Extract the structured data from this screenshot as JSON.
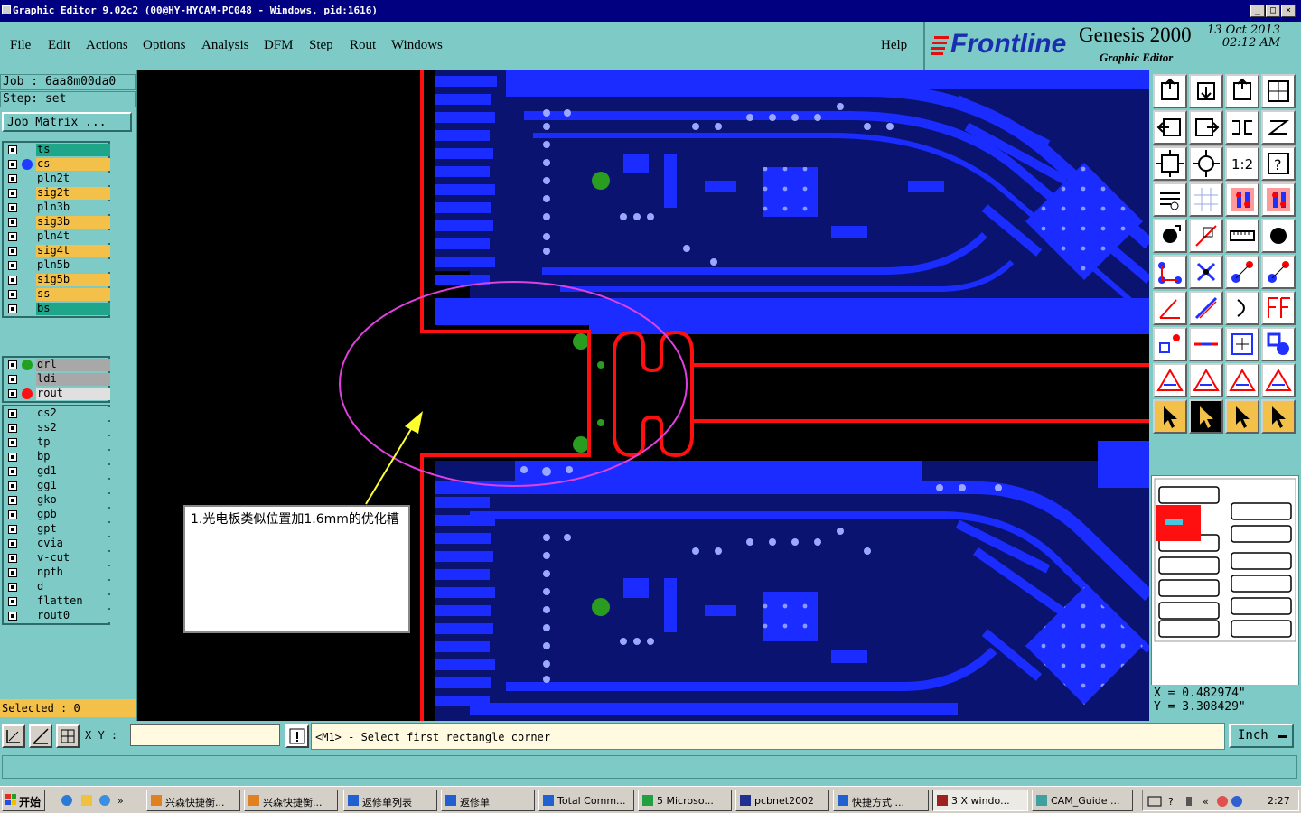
{
  "window": {
    "title": "Graphic Editor 9.02c2 (00@HY-HYCAM-PC048 - Windows, pid:1616)",
    "controls": [
      "_",
      "□",
      "×"
    ]
  },
  "menu": {
    "items": [
      "File",
      "Edit",
      "Actions",
      "Options",
      "Analysis",
      "DFM",
      "Step",
      "Rout",
      "Windows"
    ],
    "help": "Help"
  },
  "logo": {
    "brand": "Frontline",
    "product": "Genesis 2000",
    "subtitle": "Graphic Editor",
    "date": "13 Oct 2013",
    "time": "02:12 AM"
  },
  "job": {
    "job_line": "Job : 6aa8m00da0",
    "step_line": "Step: set",
    "matrix_button": "Job Matrix ..."
  },
  "layers_group1": [
    {
      "name": "ts",
      "color": "#1fa58a",
      "dot": ""
    },
    {
      "name": "cs",
      "color": "#f3c04a",
      "dot": "#1e3cff"
    },
    {
      "name": "pln2t",
      "color": "#7dcac6",
      "dot": ""
    },
    {
      "name": "sig2t",
      "color": "#f3c04a",
      "dot": ""
    },
    {
      "name": "pln3b",
      "color": "#7dcac6",
      "dot": ""
    },
    {
      "name": "sig3b",
      "color": "#f3c04a",
      "dot": ""
    },
    {
      "name": "pln4t",
      "color": "#7dcac6",
      "dot": ""
    },
    {
      "name": "sig4t",
      "color": "#f3c04a",
      "dot": ""
    },
    {
      "name": "pln5b",
      "color": "#7dcac6",
      "dot": ""
    },
    {
      "name": "sig5b",
      "color": "#f3c04a",
      "dot": ""
    },
    {
      "name": "ss",
      "color": "#f3c04a",
      "dot": ""
    },
    {
      "name": "bs",
      "color": "#1fa58a",
      "dot": ""
    }
  ],
  "layers_group2": [
    {
      "name": "drl",
      "color": "#a8a8a8",
      "dot": "#22a020"
    },
    {
      "name": "ldi",
      "color": "#a8a8a8",
      "dot": ""
    },
    {
      "name": "rout",
      "color": "#e0e0e0",
      "dot": "#ff1010"
    }
  ],
  "layers_group3": [
    {
      "name": "cs2",
      "color": "#7dcac6",
      "dot": ""
    },
    {
      "name": "ss2",
      "color": "#7dcac6",
      "dot": ""
    },
    {
      "name": "tp",
      "color": "#7dcac6",
      "dot": ""
    },
    {
      "name": "bp",
      "color": "#7dcac6",
      "dot": ""
    },
    {
      "name": "gd1",
      "color": "#7dcac6",
      "dot": ""
    },
    {
      "name": "gg1",
      "color": "#7dcac6",
      "dot": ""
    },
    {
      "name": "gko",
      "color": "#7dcac6",
      "dot": ""
    },
    {
      "name": "gpb",
      "color": "#7dcac6",
      "dot": ""
    },
    {
      "name": "gpt",
      "color": "#7dcac6",
      "dot": ""
    },
    {
      "name": "cvia",
      "color": "#7dcac6",
      "dot": ""
    },
    {
      "name": "v-cut",
      "color": "#7dcac6",
      "dot": ""
    },
    {
      "name": "npth",
      "color": "#7dcac6",
      "dot": ""
    },
    {
      "name": "d",
      "color": "#7dcac6",
      "dot": ""
    },
    {
      "name": "flatten",
      "color": "#7dcac6",
      "dot": ""
    },
    {
      "name": "rout0",
      "color": "#7dcac6",
      "dot": ""
    }
  ],
  "selected_text": "Selected : 0",
  "annotation": {
    "text": "1.光电板类似位置加1.6mm的优化槽"
  },
  "coords": {
    "x": "X = 0.482974\"",
    "y": "Y = 3.308429\""
  },
  "command": {
    "xy_label": "X Y :",
    "xy_value": "",
    "prompt": "<M1> - Select first rectangle corner",
    "unit": "Inch"
  },
  "taskbar": {
    "start": "开始",
    "tasks": [
      "兴森快捷衡...",
      "兴森快捷衡...",
      "返修单列表",
      "返修单",
      "Total Comm...",
      "5 Microso...",
      "pcbnet2002",
      "快捷方式 ...",
      "3 X windo...",
      "CAM_Guide ..."
    ],
    "clock": "2:27"
  },
  "colors": {
    "copper": "#1a2cff",
    "rout": "#ff1010",
    "pad": "#2a9c20",
    "panel": "#7dcac6",
    "highlight": "#f3c04a"
  },
  "tool_icons": [
    "zoom-home-icon",
    "zoom-in-icon",
    "zoom-home-icon",
    "zoom-fit-icon",
    "pan-left-icon",
    "pan-right-icon",
    "flip-icon",
    "snap-icon",
    "expand-icon",
    "center-icon",
    "scale-1-2-icon",
    "help-icon",
    "measure-icon",
    "grid-icon",
    "layer-red-icon",
    "layer-red-icon",
    "pad-icon",
    "line-icon",
    "ruler-icon",
    "circle-icon",
    "node-icon",
    "cross-icon",
    "connect-icon",
    "connect-icon",
    "angle-icon",
    "slash-icon",
    "arc-icon",
    "flag-icon",
    "point-icon",
    "dash-icon",
    "box-icon",
    "group-icon",
    "triangle-icon",
    "triangle-icon",
    "triangle-icon",
    "triangle-icon",
    "select-icon",
    "select-icon",
    "select-icon",
    "select-icon"
  ]
}
